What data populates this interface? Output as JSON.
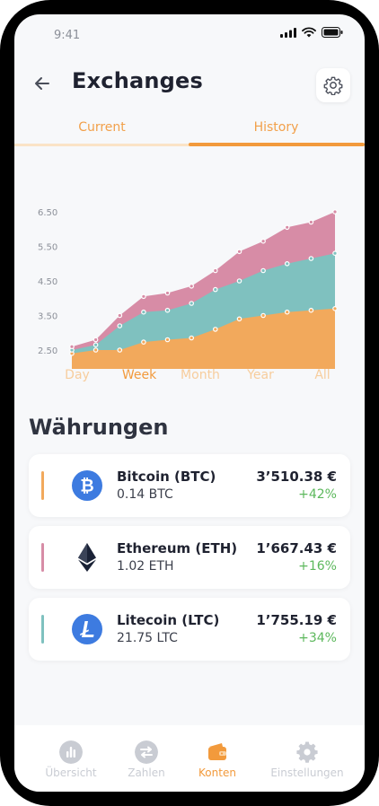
{
  "status_bar": {
    "time": "9:41"
  },
  "header": {
    "title": "Exchanges"
  },
  "tabs": [
    {
      "label": "Current"
    },
    {
      "label": "History"
    }
  ],
  "chart_data": {
    "type": "area",
    "stacked": true,
    "y_ticks": [
      "6.50",
      "5.50",
      "4.50",
      "3.50",
      "2.50"
    ],
    "ylim": [
      2.0,
      6.5
    ],
    "x_points": 12,
    "series": [
      {
        "color": "#f2a95c",
        "values": [
          2.4,
          2.5,
          2.5,
          2.73,
          2.8,
          2.85,
          3.1,
          3.4,
          3.5,
          3.6,
          3.65,
          3.7
        ]
      },
      {
        "color": "#7fc1bf",
        "values": [
          2.5,
          2.65,
          3.2,
          3.6,
          3.65,
          3.85,
          4.25,
          4.5,
          4.8,
          5.0,
          5.15,
          5.3
        ]
      },
      {
        "color": "#d78ca6",
        "values": [
          2.6,
          2.8,
          3.5,
          4.05,
          4.15,
          4.35,
          4.8,
          5.35,
          5.65,
          6.05,
          6.2,
          6.5
        ]
      }
    ],
    "grid": false,
    "legend": "none"
  },
  "periods": {
    "items": [
      "Day",
      "Week",
      "Month",
      "Year",
      "All"
    ],
    "active": "Week"
  },
  "section": {
    "title": "Währungen"
  },
  "currencies": [
    {
      "name": "Bitcoin (BTC)",
      "amount": "0.14 BTC",
      "value": "3’510.38 €",
      "change": "+42%",
      "accent": "#f2a95c",
      "icon": "bitcoin-icon"
    },
    {
      "name": "Ethereum (ETH)",
      "amount": "1.02 ETH",
      "value": "1’667.43 €",
      "change": "+16%",
      "accent": "#d78ca6",
      "icon": "ethereum-icon"
    },
    {
      "name": "Litecoin (LTC)",
      "amount": "21.75 LTC",
      "value": "1’755.19 €",
      "change": "+34%",
      "accent": "#7fc1bf",
      "icon": "litecoin-icon"
    }
  ],
  "nav": [
    {
      "label": "Übersicht",
      "icon": "chart-icon"
    },
    {
      "label": "Zahlen",
      "icon": "transfer-icon"
    },
    {
      "label": "Konten",
      "icon": "wallet-icon"
    },
    {
      "label": "Einstellungen",
      "icon": "gear-icon"
    }
  ],
  "nav_active": "Konten",
  "colors": {
    "accent": "#f29a3c",
    "positive": "#5cb85c"
  }
}
